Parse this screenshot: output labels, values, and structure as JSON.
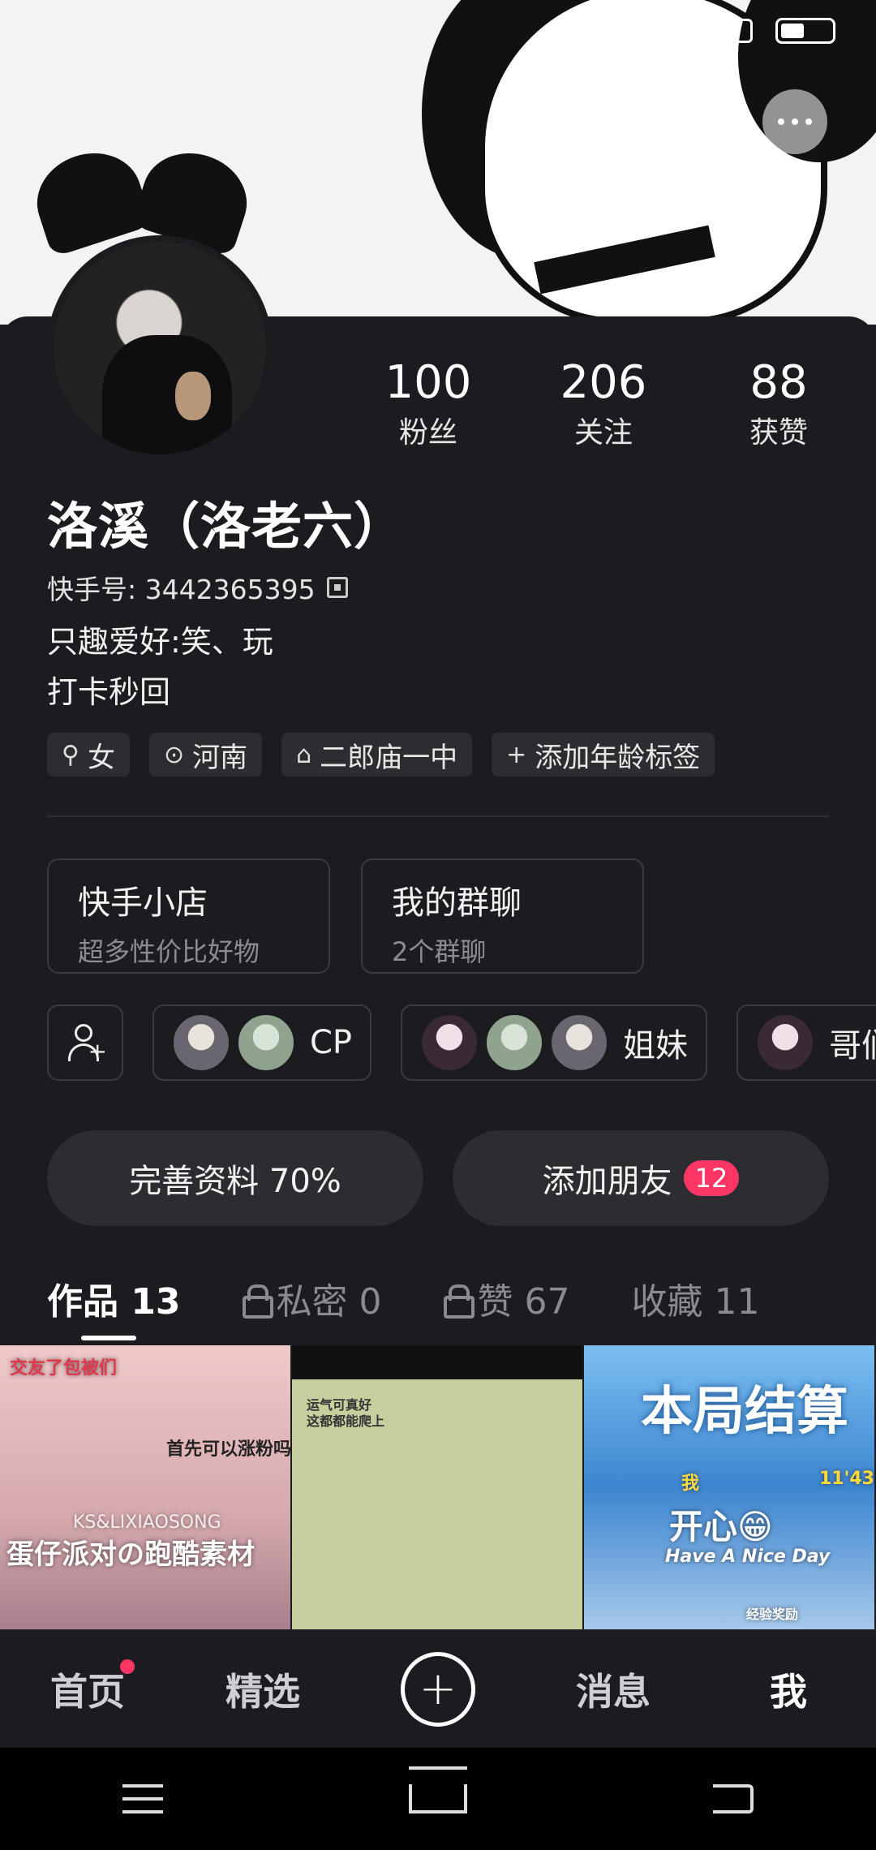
{
  "profile": {
    "stats": [
      {
        "value": "100",
        "label": "粉丝"
      },
      {
        "value": "206",
        "label": "关注"
      },
      {
        "value": "88",
        "label": "获赞"
      }
    ],
    "name": "洛溪（洛老六）",
    "kuaishou_id": "快手号: 3442365395",
    "bio_line1": "只趣爱好:笑、玩",
    "bio_line2": "打卡秒回",
    "tags": [
      {
        "icon": "gender-icon",
        "label": "女"
      },
      {
        "icon": "location-icon",
        "label": "河南"
      },
      {
        "icon": "school-icon",
        "label": "二郎庙一中"
      },
      {
        "icon": "plus-icon",
        "label": "添加年龄标签"
      }
    ]
  },
  "boxes": [
    {
      "title": "快手小店",
      "subtitle": "超多性价比好物"
    },
    {
      "title": "我的群聊",
      "subtitle": "2个群聊"
    }
  ],
  "friends": {
    "groups": [
      {
        "label": "CP"
      },
      {
        "label": "姐妹"
      },
      {
        "label": "哥们"
      }
    ]
  },
  "actions": {
    "complete_profile": "完善资料 70%",
    "add_friends": "添加朋友",
    "add_friends_badge": "12"
  },
  "tabs": [
    {
      "label": "作品 13",
      "locked": false
    },
    {
      "label": "私密 0",
      "locked": true
    },
    {
      "label": "赞 67",
      "locked": true
    },
    {
      "label": "收藏 11",
      "locked": false
    }
  ],
  "thumbnails": [
    {
      "lines": [
        "交友了包被们",
        "首先可以涨粉吗",
        "KS&LIXIAOSONG",
        "蛋仔派对の跑酷素材"
      ]
    },
    {
      "lines": [
        "运气可真好",
        "这都都能爬上"
      ]
    },
    {
      "lines": [
        "本局结算",
        "我",
        "11'43",
        "开心😁",
        "Have A Nice Day",
        "经验奖励"
      ]
    }
  ],
  "bottom_nav": {
    "home": "首页",
    "featured": "精选",
    "create": "+",
    "messages": "消息",
    "me": "我"
  }
}
